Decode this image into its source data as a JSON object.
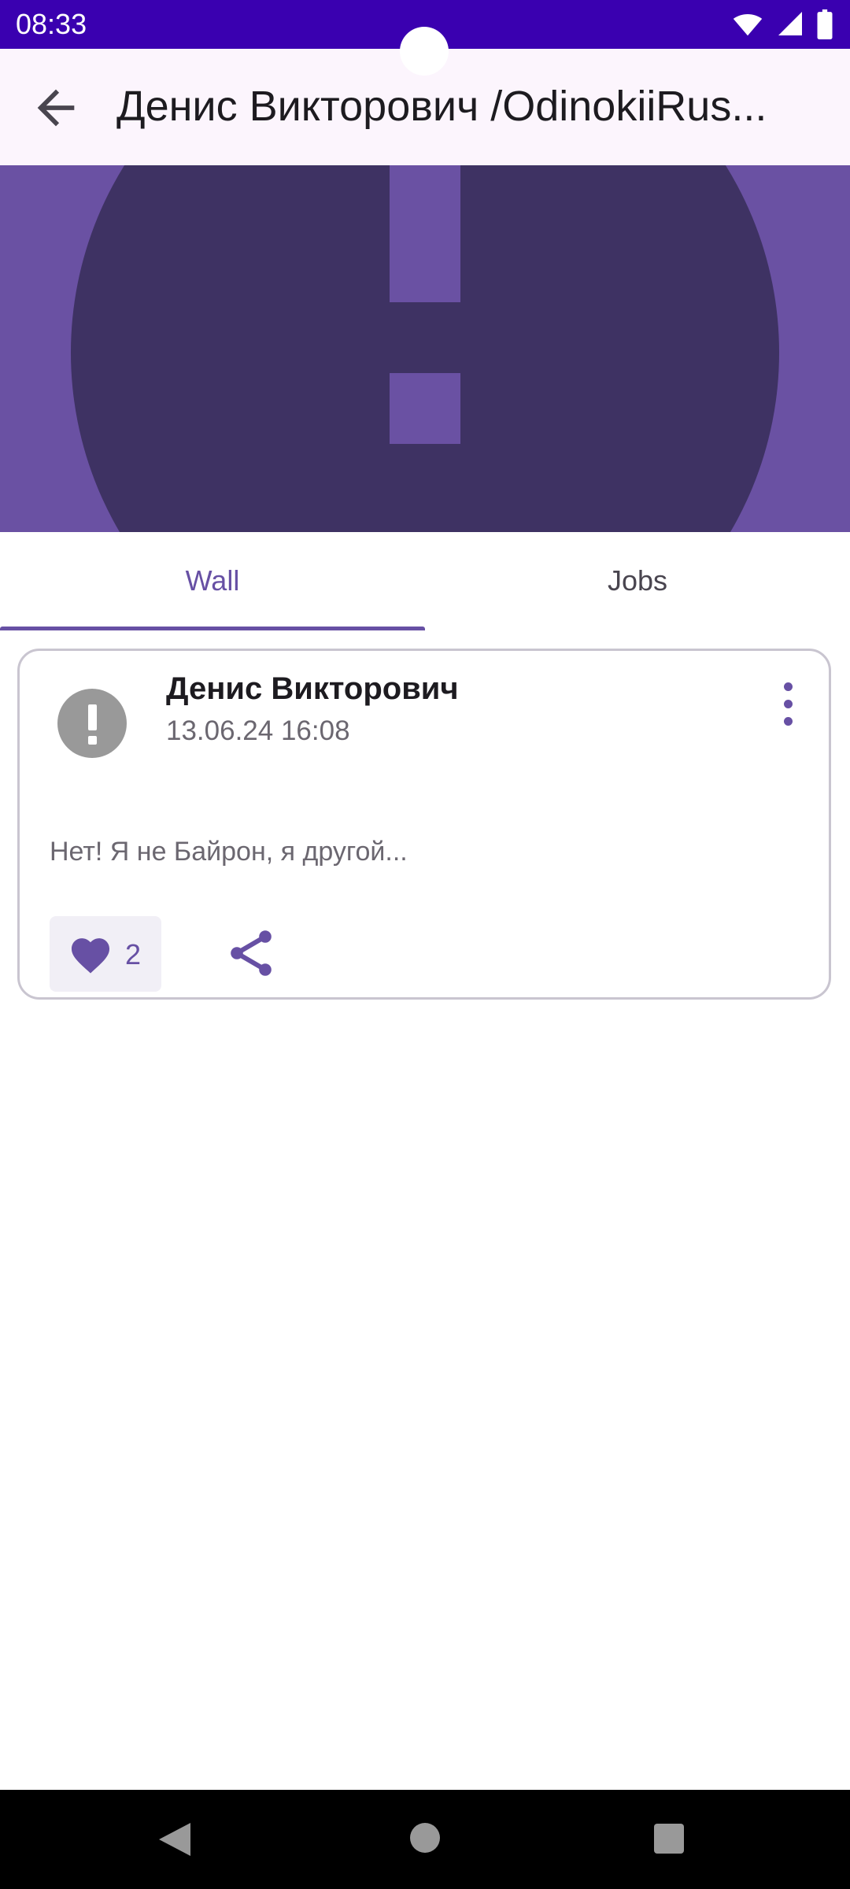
{
  "status_bar": {
    "time": "08:33",
    "icons": [
      "wifi-icon",
      "signal-icon",
      "battery-icon"
    ]
  },
  "app_bar": {
    "title": "Денис Викторович /OdinokiiRus...",
    "back_icon": "arrow-back-icon"
  },
  "tabs": [
    {
      "label": "Wall",
      "selected": true
    },
    {
      "label": "Jobs",
      "selected": false
    }
  ],
  "post": {
    "author": "Денис Викторович",
    "date": "13.06.24 16:08",
    "text": "Нет! Я не Байрон, я другой...",
    "likes": "2",
    "liked": true
  },
  "colors": {
    "primary": "#6750a4",
    "status_bar": "#3a00b0",
    "header_bg": "#6a51a3",
    "header_circle": "#3e3263"
  }
}
